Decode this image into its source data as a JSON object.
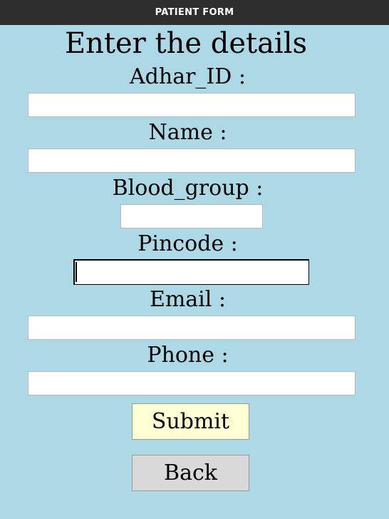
{
  "window": {
    "title": "PATIENT FORM"
  },
  "form": {
    "heading": "Enter the details",
    "fields": [
      {
        "label": "Adhar_ID :",
        "value": ""
      },
      {
        "label": "Name :",
        "value": ""
      },
      {
        "label": "Blood_group :",
        "value": ""
      },
      {
        "label": "Pincode :",
        "value": ""
      },
      {
        "label": "Email :",
        "value": ""
      },
      {
        "label": "Phone :",
        "value": ""
      }
    ],
    "submit_label": "Submit",
    "back_label": "Back"
  },
  "colors": {
    "background": "#add8e6",
    "titlebar": "#2f2e2f",
    "submit_button": "#fffed5",
    "back_button": "#d9d9d9"
  }
}
